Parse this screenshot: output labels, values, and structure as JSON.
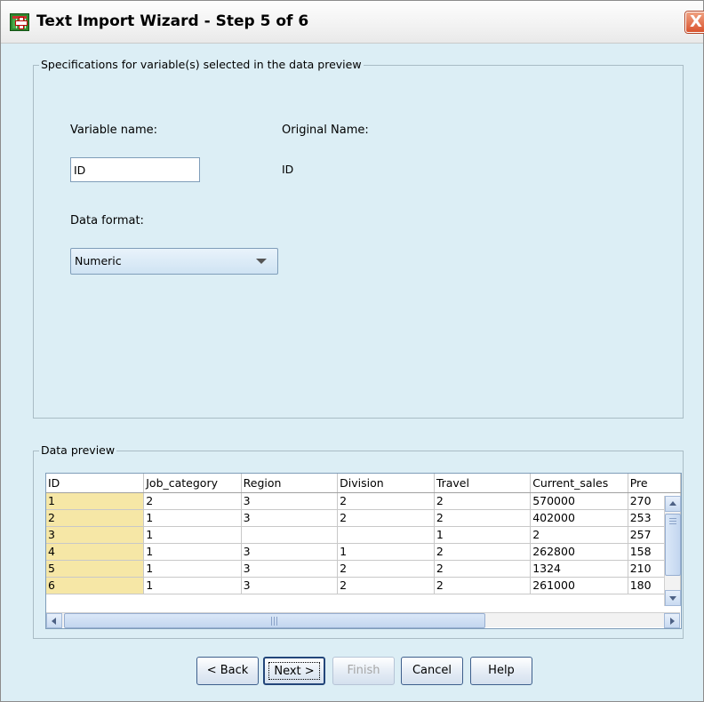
{
  "window": {
    "title": "Text Import Wizard - Step 5 of 6",
    "close_glyph": "X"
  },
  "spec_group": {
    "legend": "Specifications for variable(s) selected in the data preview",
    "variable_name_label": "Variable name:",
    "variable_name_value": "ID",
    "original_name_label": "Original Name:",
    "original_name_value": "ID",
    "data_format_label": "Data format:",
    "data_format_value": "Numeric"
  },
  "preview_group": {
    "legend": "Data preview",
    "columns": [
      "ID",
      "Job_category",
      "Region",
      "Division",
      "Travel",
      "Current_sales",
      "Pre"
    ],
    "rows": [
      [
        "1",
        "2",
        "3",
        "2",
        "2",
        "570000",
        "270"
      ],
      [
        "2",
        "1",
        "3",
        "2",
        "2",
        "402000",
        "253"
      ],
      [
        "3",
        "1",
        "",
        "",
        "1",
        "2",
        "257"
      ],
      [
        "4",
        "1",
        "3",
        "1",
        "2",
        "262800",
        "158"
      ],
      [
        "5",
        "1",
        "3",
        "2",
        "2",
        "1324",
        "210"
      ],
      [
        "6",
        "1",
        "3",
        "2",
        "2",
        "261000",
        "180"
      ]
    ]
  },
  "buttons": {
    "back": "< Back",
    "next": "Next >",
    "finish": "Finish",
    "cancel": "Cancel",
    "help": "Help"
  },
  "icons": {
    "app": "spss-data-icon",
    "close": "close-icon"
  }
}
